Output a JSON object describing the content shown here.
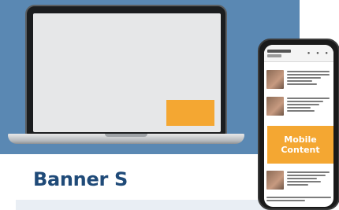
{
  "banner": {
    "title": "Banner S"
  },
  "mobile_ad": {
    "line1": "Mobile",
    "line2": "Content"
  },
  "colors": {
    "panel": "#5a88b3",
    "ad": "#f4a732",
    "title": "#1f4a78"
  },
  "phone_header_icons": "● ● ●"
}
